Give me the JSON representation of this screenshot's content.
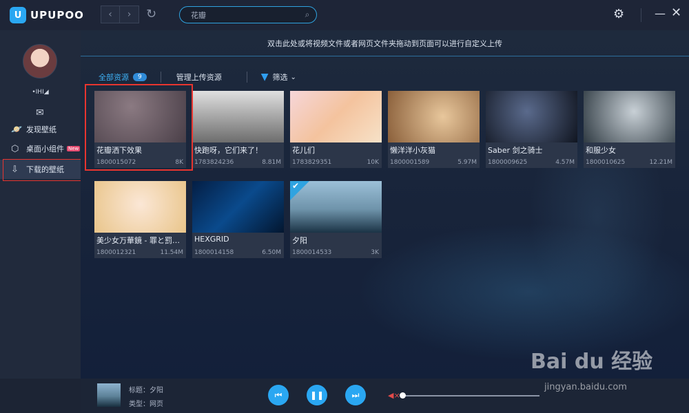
{
  "app": {
    "logo_text": "UPUPOO"
  },
  "nav": {
    "back_glyph": "‹",
    "forward_glyph": "›"
  },
  "search": {
    "value": "花瓣"
  },
  "sidebar": {
    "username": "•IHI◢",
    "items": [
      {
        "label": "发现壁纸",
        "icon": "planet-icon"
      },
      {
        "label": "桌面小组件",
        "icon": "hexagon-icon",
        "badge": "New"
      },
      {
        "label": "下载的壁纸",
        "icon": "download-arrow-icon",
        "active": true
      }
    ]
  },
  "main": {
    "banner": "双击此处或将视频文件或者网页文件夹拖动到页面可以进行自定义上传",
    "tabs": {
      "all_label": "全部资源",
      "all_count": "9",
      "manage_label": "管理上传资源",
      "filter_label": "筛选"
    },
    "cards": [
      {
        "title": "花瓣洒下效果",
        "id": "1800015072",
        "size": "8K",
        "thumb_color": "#6b5a62"
      },
      {
        "title": "快跑呀，它们来了！",
        "id": "1783824236",
        "size": "8.81M",
        "thumb_color": "#bdbdbd"
      },
      {
        "title": "花儿们",
        "id": "1783829351",
        "size": "10K",
        "thumb_color": "#f0c9c9"
      },
      {
        "title": "懒洋洋小灰猫",
        "id": "1800001589",
        "size": "5.97M",
        "thumb_color": "#c09064"
      },
      {
        "title": "Saber 剑之骑士",
        "id": "1800009625",
        "size": "4.57M",
        "thumb_color": "#2a3040"
      },
      {
        "title": "和服少女",
        "id": "1800010625",
        "size": "12.21M",
        "thumb_color": "#3d4852"
      },
      {
        "title": "美少女万華鏡 - 罪と罰…",
        "id": "1800012321",
        "size": "11.54M",
        "thumb_color": "#f3dcc0"
      },
      {
        "title": "HEXGRID",
        "id": "1800014158",
        "size": "6.50M",
        "thumb_color": "#0a2a55"
      },
      {
        "title": "夕阳",
        "id": "1800014533",
        "size": "3K",
        "thumb_color": "#4f7a94",
        "selected": true
      }
    ]
  },
  "player": {
    "title": "标题：夕阳",
    "type": "类型：网页",
    "prev_glyph": "⏮",
    "pause_glyph": "❚❚",
    "next_glyph": "⏭",
    "volume_level": 0.0
  },
  "watermark": {
    "main": "Bai du 经验",
    "sub": "jingyan.baidu.com"
  }
}
